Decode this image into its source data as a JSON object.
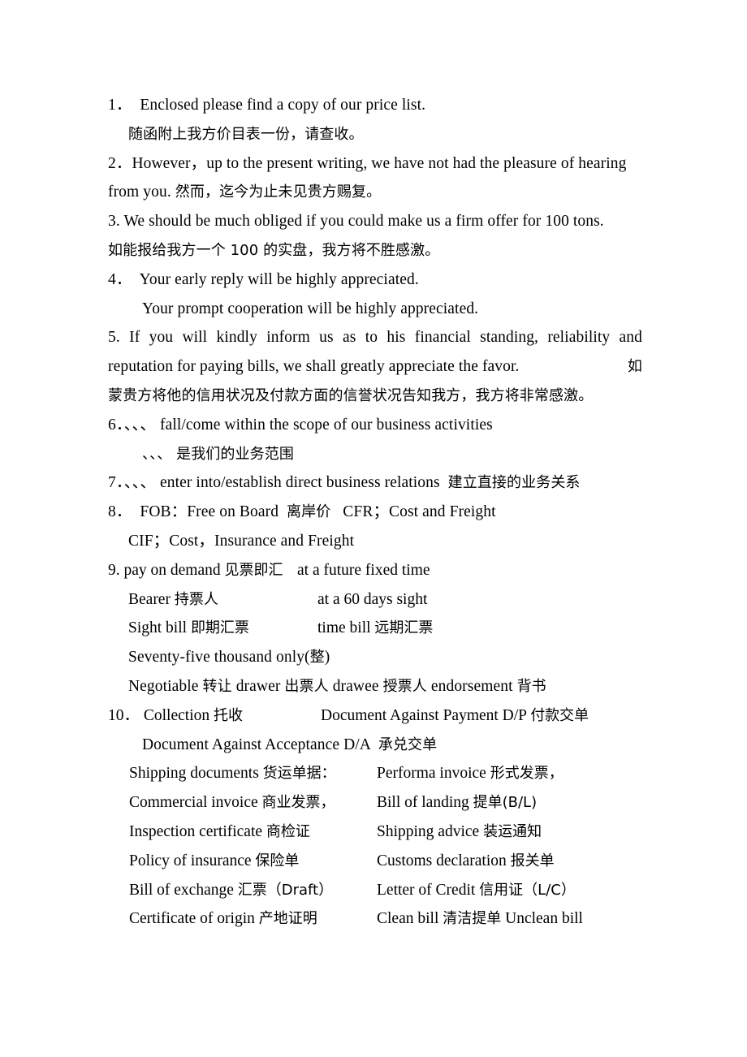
{
  "document": {
    "lines": [
      {
        "id": "item1-en",
        "text": "1．  Enclosed please find a copy of our price list."
      },
      {
        "id": "item1-zh",
        "text": "随函附上我方价目表一份，请查收。"
      },
      {
        "id": "item2-en1",
        "text": "2．However，up to the present writing, we have not had the pleasure of hearing"
      },
      {
        "id": "item2-en2",
        "text": "from you. "
      },
      {
        "id": "item2-zh",
        "text": "然而，迄今为止未见贵方赐复。"
      },
      {
        "id": "item3-en",
        "text": "3. We should be much obliged if you could make us a firm offer for 100 tons."
      },
      {
        "id": "item3-zh",
        "text": "如能报给我方一个 100 的实盘，我方将不胜感激。"
      },
      {
        "id": "item4-en1",
        "text": "4．  Your early reply will be highly appreciated."
      },
      {
        "id": "item4-en2",
        "text": "Your prompt cooperation will be highly appreciated."
      },
      {
        "id": "item5-en1",
        "text": "5. If you will kindly inform us as to his financial standing, reliability and"
      },
      {
        "id": "item5-en2",
        "text": "reputation for paying bills, we shall greatly appreciate the favor."
      },
      {
        "id": "item5-zh-head",
        "text": "如"
      },
      {
        "id": "item5-zh",
        "text": "蒙贵方将他的信用状况及付款方面的信誉状况告知我方，我方将非常感激。"
      },
      {
        "id": "item6-en",
        "text": "6．、、、 fall/come within the scope of our business activities"
      },
      {
        "id": "item6-zh",
        "text": "、、、 是我们的业务范围"
      },
      {
        "id": "item7-en",
        "text": "7．、、、 enter into/establish direct business relations  "
      },
      {
        "id": "item7-zh",
        "text": "建立直接的业务关系"
      },
      {
        "id": "item8-l1-a",
        "text": "8．  FOB：Free on Board  "
      },
      {
        "id": "item8-l1-zh",
        "text": "离岸价"
      },
      {
        "id": "item8-l1-b",
        "text": "   CFR；Cost and Freight"
      },
      {
        "id": "item8-l2",
        "text": "CIF；Cost，Insurance and Freight"
      }
    ],
    "item9": {
      "head_left": "9. pay on demand  ",
      "head_left_zh": "见票即汇",
      "head_right": "at a future fixed time",
      "rows": [
        {
          "left_en": "Bearer  ",
          "left_zh": "持票人",
          "right_en": "at a 60 days sight",
          "right_zh": ""
        },
        {
          "left_en": "Sight bill  ",
          "left_zh": "即期汇票",
          "right_en": "time bill  ",
          "right_zh": "远期汇票"
        }
      ],
      "amount_line_en": "Seventy-five thousand only(",
      "amount_line_zh": "整",
      "amount_line_en2": ")",
      "endorse": [
        {
          "en": "Negotiable  ",
          "zh": "转让"
        },
        {
          "en": " drawer  ",
          "zh": "出票人"
        },
        {
          "en": "    drawee  ",
          "zh": "授票人"
        },
        {
          "en": "  endorsement  ",
          "zh": "背书"
        }
      ]
    },
    "item10": {
      "head_left_en": "10．  Collection  ",
      "head_left_zh": "托收",
      "head_right_en": "Document Against Payment D/P  ",
      "head_right_zh": "付款交单",
      "acceptance_en": "Document Against Acceptance D/A  ",
      "acceptance_zh": "承兑交单",
      "docs": [
        {
          "left_en": "Shipping documents ",
          "left_zh": "货运单据：",
          "right_en": "Performa invoice  ",
          "right_zh": "形式发票，"
        },
        {
          "left_en": "Commercial invoice ",
          "left_zh": "商业发票，",
          "right_en": " Bill of landing ",
          "right_zh": "提单(B/L)"
        },
        {
          "left_en": "Inspection certificate  ",
          "left_zh": "商检证",
          "right_en": "Shipping advice  ",
          "right_zh": "装运通知"
        },
        {
          "left_en": "Policy of insurance  ",
          "left_zh": "保险单",
          "right_en": "Customs declaration  ",
          "right_zh": "报关单"
        },
        {
          "left_en": "Bill of exchange  ",
          "left_zh": "汇票（Draft）",
          "right_en": " Letter of Credit  ",
          "right_zh": "信用证（L/C）"
        },
        {
          "left_en": "Certificate of origin  ",
          "left_zh": "产地证明",
          "right_en": "Clean bill  ",
          "right_zh": "清洁提单",
          "right_en2": "   Unclean bill"
        }
      ]
    }
  }
}
